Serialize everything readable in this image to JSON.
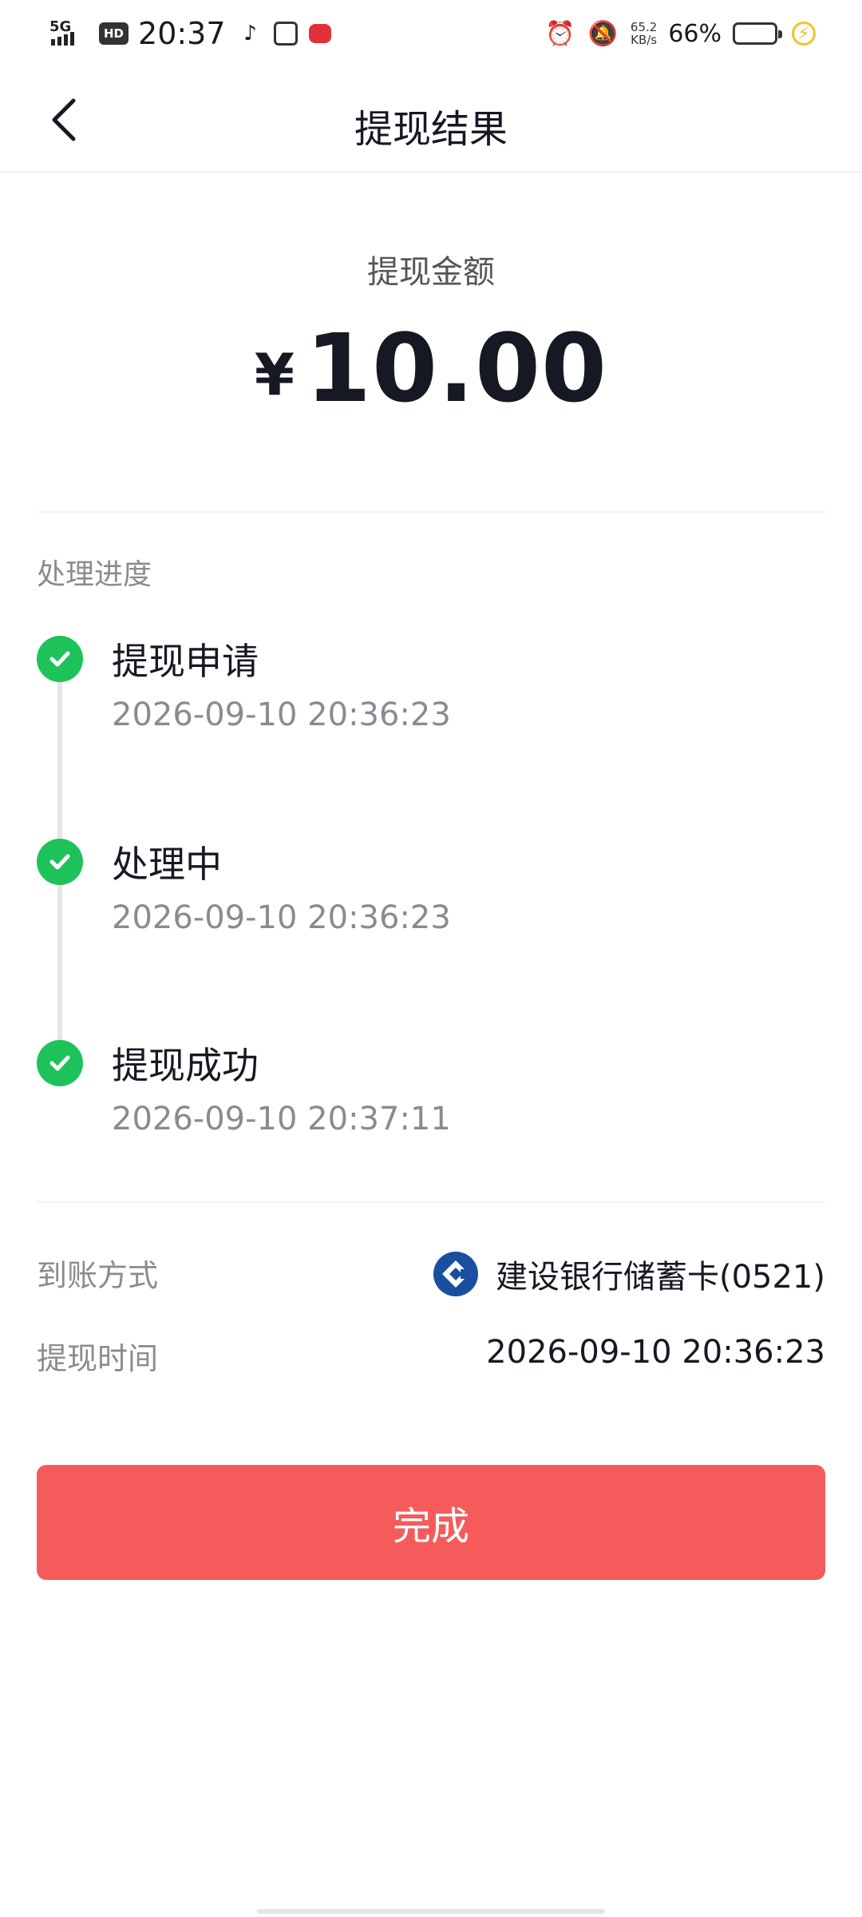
{
  "status_bar": {
    "network": "5G",
    "hd": "HD",
    "time": "20:37",
    "speed_value": "65.2",
    "speed_unit": "KB/s",
    "battery_percent": "66%",
    "battery_level": 0.66,
    "icons": [
      "tiktok-icon",
      "wallet-icon",
      "message-icon",
      "alarm-icon",
      "bell-off-icon",
      "charging-icon"
    ]
  },
  "nav": {
    "title": "提现结果"
  },
  "amount": {
    "label": "提现金额",
    "currency": "¥",
    "value": "10.00"
  },
  "progress": {
    "label": "处理进度",
    "steps": [
      {
        "title": "提现申请",
        "time": "2026-09-10 20:36:23",
        "status": "done"
      },
      {
        "title": "处理中",
        "time": "2026-09-10 20:36:23",
        "status": "done"
      },
      {
        "title": "提现成功",
        "time": "2026-09-10 20:37:11",
        "status": "done"
      }
    ]
  },
  "details": {
    "method_label": "到账方式",
    "method_value": "建设银行储蓄卡(0521)",
    "time_label": "提现时间",
    "time_value": "2026-09-10 20:36:23"
  },
  "done_button": {
    "label": "完成"
  },
  "colors": {
    "accent": "#f65b5b",
    "success": "#1ec25a",
    "bank_blue": "#1a4fa0"
  }
}
